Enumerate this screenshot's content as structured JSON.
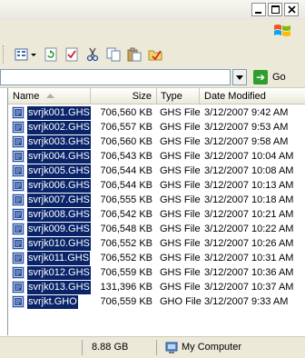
{
  "toolbar": {
    "icons": [
      "views-icon",
      "refresh-icon",
      "properties-icon",
      "cut-icon",
      "copy-icon",
      "paste-icon",
      "folder-options-icon"
    ]
  },
  "address": {
    "value": "",
    "go_label": "Go"
  },
  "columns": [
    {
      "key": "name",
      "label": "Name",
      "sorted": "ascending"
    },
    {
      "key": "size",
      "label": "Size"
    },
    {
      "key": "type",
      "label": "Type"
    },
    {
      "key": "modified",
      "label": "Date Modified"
    }
  ],
  "files": [
    {
      "name": "svrjk001.GHS",
      "size": "706,560 KB",
      "type": "GHS File",
      "modified": "3/12/2007 9:42 AM",
      "selected": true
    },
    {
      "name": "svrjk002.GHS",
      "size": "706,557 KB",
      "type": "GHS File",
      "modified": "3/12/2007 9:53 AM",
      "selected": true
    },
    {
      "name": "svrjk003.GHS",
      "size": "706,560 KB",
      "type": "GHS File",
      "modified": "3/12/2007 9:58 AM",
      "selected": true
    },
    {
      "name": "svrjk004.GHS",
      "size": "706,543 KB",
      "type": "GHS File",
      "modified": "3/12/2007 10:04 AM",
      "selected": true
    },
    {
      "name": "svrjk005.GHS",
      "size": "706,544 KB",
      "type": "GHS File",
      "modified": "3/12/2007 10:08 AM",
      "selected": true
    },
    {
      "name": "svrjk006.GHS",
      "size": "706,544 KB",
      "type": "GHS File",
      "modified": "3/12/2007 10:13 AM",
      "selected": true
    },
    {
      "name": "svrjk007.GHS",
      "size": "706,555 KB",
      "type": "GHS File",
      "modified": "3/12/2007 10:18 AM",
      "selected": true
    },
    {
      "name": "svrjk008.GHS",
      "size": "706,542 KB",
      "type": "GHS File",
      "modified": "3/12/2007 10:21 AM",
      "selected": true
    },
    {
      "name": "svrjk009.GHS",
      "size": "706,548 KB",
      "type": "GHS File",
      "modified": "3/12/2007 10:22 AM",
      "selected": true
    },
    {
      "name": "svrjk010.GHS",
      "size": "706,552 KB",
      "type": "GHS File",
      "modified": "3/12/2007 10:26 AM",
      "selected": true
    },
    {
      "name": "svrjk011.GHS",
      "size": "706,552 KB",
      "type": "GHS File",
      "modified": "3/12/2007 10:31 AM",
      "selected": true
    },
    {
      "name": "svrjk012.GHS",
      "size": "706,559 KB",
      "type": "GHS File",
      "modified": "3/12/2007 10:36 AM",
      "selected": true
    },
    {
      "name": "svrjk013.GHS",
      "size": "131,396 KB",
      "type": "GHS File",
      "modified": "3/12/2007 10:37 AM",
      "selected": true
    },
    {
      "name": "svrjkt.GHO",
      "size": "706,559 KB",
      "type": "GHO File",
      "modified": "3/12/2007 9:33 AM",
      "selected": true
    }
  ],
  "status": {
    "size": "8.88 GB",
    "location": "My Computer"
  },
  "colors": {
    "selection": "#0a246a",
    "chrome": "#ece9d8"
  }
}
